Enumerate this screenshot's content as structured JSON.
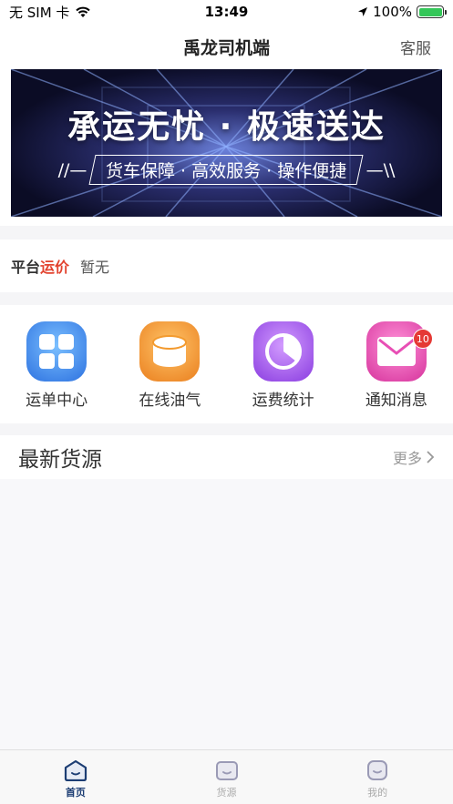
{
  "status_bar": {
    "carrier": "无 SIM 卡",
    "time": "13:49",
    "battery": "100%"
  },
  "nav": {
    "title": "禹龙司机端",
    "right_action": "客服"
  },
  "banner": {
    "title": "承运无忧 · 极速送达",
    "subtitle": "货车保障 · 高效服务 · 操作便捷",
    "left_decoration": "//—",
    "right_decoration": "—\\\\"
  },
  "price": {
    "label_part1": "平台",
    "label_part2": "运价",
    "value": "暂无"
  },
  "grid": {
    "items": [
      {
        "label": "运单中心",
        "icon": "grid-squares-icon",
        "color": "#3d8ff0"
      },
      {
        "label": "在线油气",
        "icon": "cylinder-icon",
        "color": "#f39a2e"
      },
      {
        "label": "运费统计",
        "icon": "pie-chart-icon",
        "color": "#a85ce6"
      },
      {
        "label": "通知消息",
        "icon": "envelope-icon",
        "color": "#e84fb5",
        "badge": "10"
      }
    ]
  },
  "latest": {
    "title": "最新货源",
    "more": "更多"
  },
  "tabs": [
    {
      "label": "首页",
      "icon": "home-tab-icon",
      "active": true
    },
    {
      "label": "货源",
      "icon": "goods-tab-icon",
      "active": false
    },
    {
      "label": "我的",
      "icon": "profile-tab-icon",
      "active": false
    }
  ]
}
